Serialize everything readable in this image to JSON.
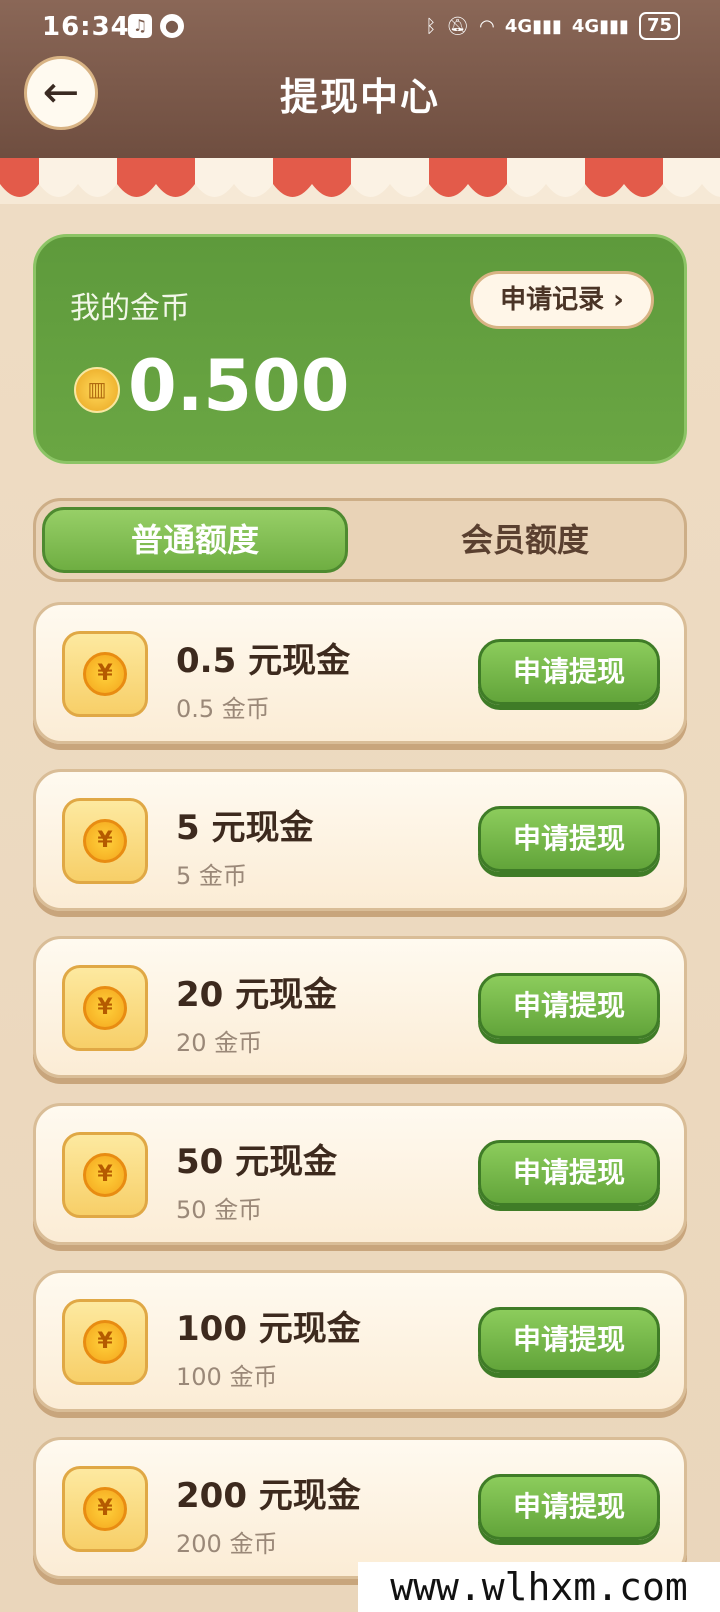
{
  "status_bar": {
    "time": "16:34",
    "network_1": "4G",
    "network_2": "4G",
    "battery": "75"
  },
  "header": {
    "title": "提现中心",
    "back_icon": "arrow-left-icon"
  },
  "balance": {
    "label": "我的金币",
    "record_button": "申请记录 ›",
    "value": "0.500"
  },
  "tabs": [
    {
      "label": "普通额度",
      "active": true
    },
    {
      "label": "会员额度",
      "active": false
    }
  ],
  "withdraw_options": [
    {
      "title": "0.5 元现金",
      "subtitle": "0.5 金币",
      "button": "申请提现"
    },
    {
      "title": "5 元现金",
      "subtitle": "5 金币",
      "button": "申请提现"
    },
    {
      "title": "20 元现金",
      "subtitle": "20 金币",
      "button": "申请提现"
    },
    {
      "title": "50 元现金",
      "subtitle": "50 金币",
      "button": "申请提现"
    },
    {
      "title": "100 元现金",
      "subtitle": "100 金币",
      "button": "申请提现"
    },
    {
      "title": "200 元现金",
      "subtitle": "200 金币",
      "button": "申请提现"
    }
  ],
  "watermark": "www.wlhxm.com",
  "colors": {
    "header": "#7a5848",
    "accent_green": "#6aa643",
    "awning_red": "#e35b4a",
    "background": "#efddc5"
  }
}
